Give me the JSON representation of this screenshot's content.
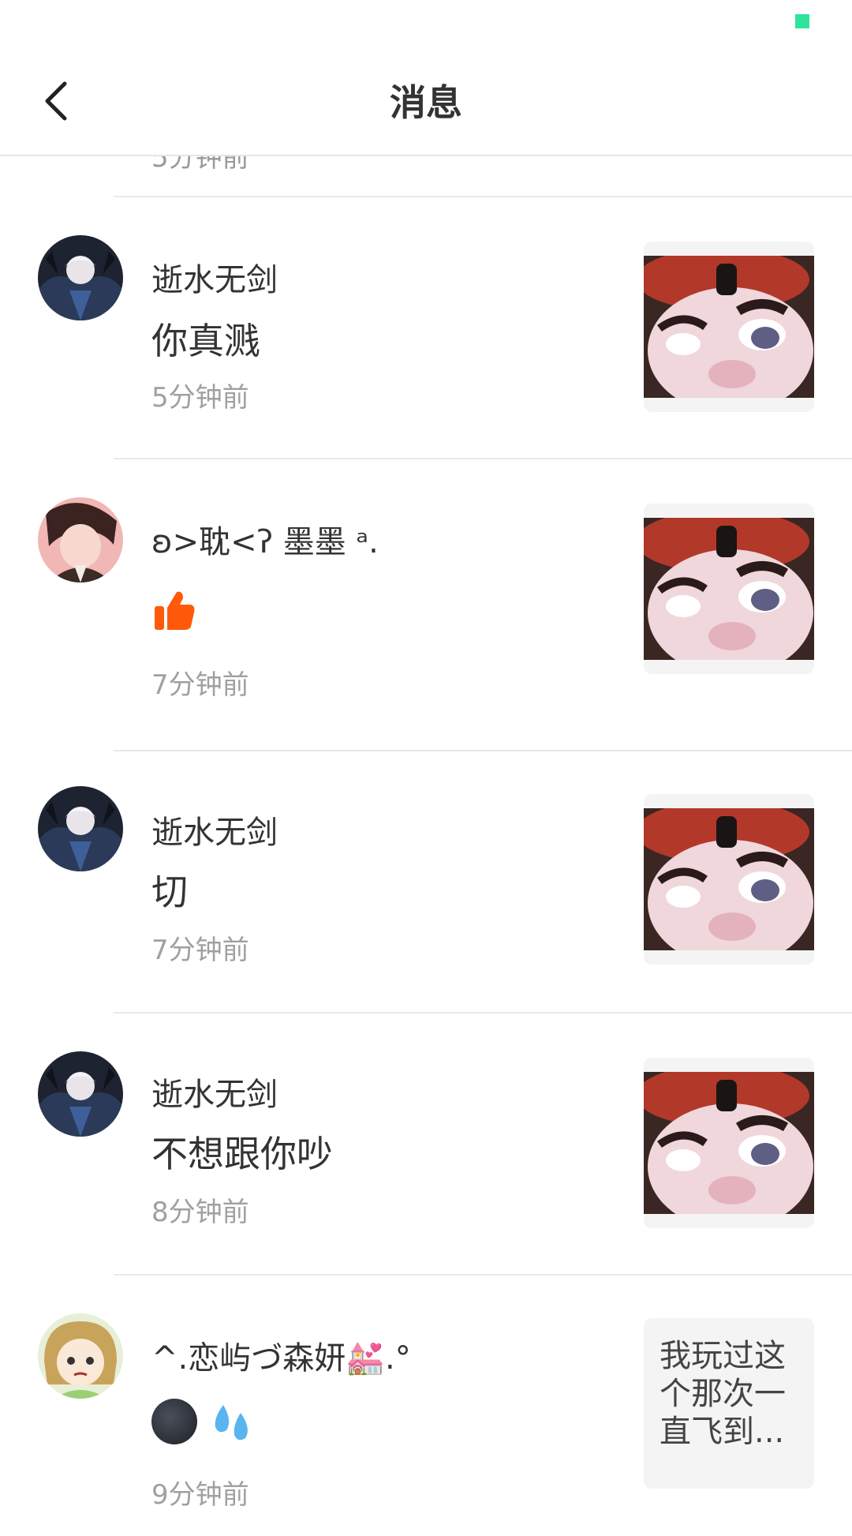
{
  "header": {
    "title": "消息"
  },
  "partial_item": {
    "time": "5分钟前"
  },
  "items": [
    {
      "name": "逝水无剑",
      "message": "你真溅",
      "time": "5分钟前",
      "avatar": "dark-armored-avatar",
      "thumb": "cartoon-pig-image"
    },
    {
      "name": "ʚ>耽<ʔ 墨墨 ᵃ.",
      "message_icon": "thumbs-up-icon",
      "time": "7分钟前",
      "avatar": "anime-man-avatar",
      "thumb": "cartoon-pig-image"
    },
    {
      "name": "逝水无剑",
      "message": "切",
      "time": "7分钟前",
      "avatar": "dark-armored-avatar",
      "thumb": "cartoon-pig-image"
    },
    {
      "name": "逝水无剑",
      "message": "不想跟你吵",
      "time": "8分钟前",
      "avatar": "dark-armored-avatar",
      "thumb": "cartoon-pig-image"
    },
    {
      "name": "^.恋屿づ森妍💒.°",
      "message_icons": [
        "new-moon-face-icon",
        "sweat-droplets-icon"
      ],
      "time": "9分钟前",
      "avatar": "anime-girl-avatar",
      "thumb_text": "我玩过这个那次一直飞到..."
    }
  ],
  "colors": {
    "accent_status": "#2fe39d",
    "thumbs_up": "#ff5a0a",
    "secondary_text": "#a0a0a0"
  }
}
